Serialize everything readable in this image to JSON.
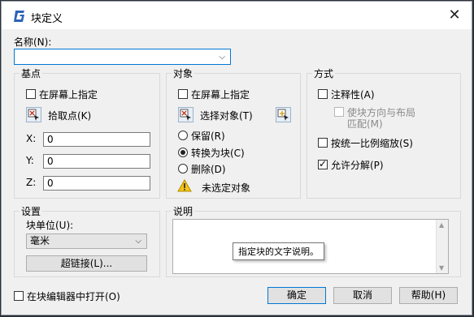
{
  "window": {
    "title": "块定义",
    "close_glyph": "✕",
    "app_icon_letter": "G"
  },
  "name_field": {
    "label": "名称(N):",
    "value": ""
  },
  "basepoint": {
    "legend": "基点",
    "specify_on_screen": "在屏幕上指定",
    "pick_point": "拾取点(K)",
    "x_label": "X:",
    "x_value": "0",
    "y_label": "Y:",
    "y_value": "0",
    "z_label": "Z:",
    "z_value": "0"
  },
  "objects": {
    "legend": "对象",
    "specify_on_screen": "在屏幕上指定",
    "select_objects": "选择对象(T)",
    "retain": "保留(R)",
    "convert": "转换为块(C)",
    "delete": "删除(D)",
    "warning_text": "未选定对象",
    "selected_option": "convert"
  },
  "behavior": {
    "legend": "方式",
    "annotative": "注释性(A)",
    "match_orientation": "使块方向与布局",
    "match_orientation_line2": "匹配(M)",
    "uniform_scale": "按统一比例缩放(S)",
    "allow_explode": "允许分解(P)",
    "allow_explode_checked": true
  },
  "settings": {
    "legend": "设置",
    "unit_label": "块单位(U):",
    "unit_value": "毫米",
    "hyperlink": "超链接(L)..."
  },
  "description": {
    "legend": "说明",
    "tooltip": "指定块的文字说明。"
  },
  "footer": {
    "open_in_editor": "在块编辑器中打开(O)",
    "ok": "确定",
    "cancel": "取消",
    "help": "帮助(H)"
  },
  "colors": {
    "accent": "#0078d7",
    "warning": "#f5c518"
  }
}
